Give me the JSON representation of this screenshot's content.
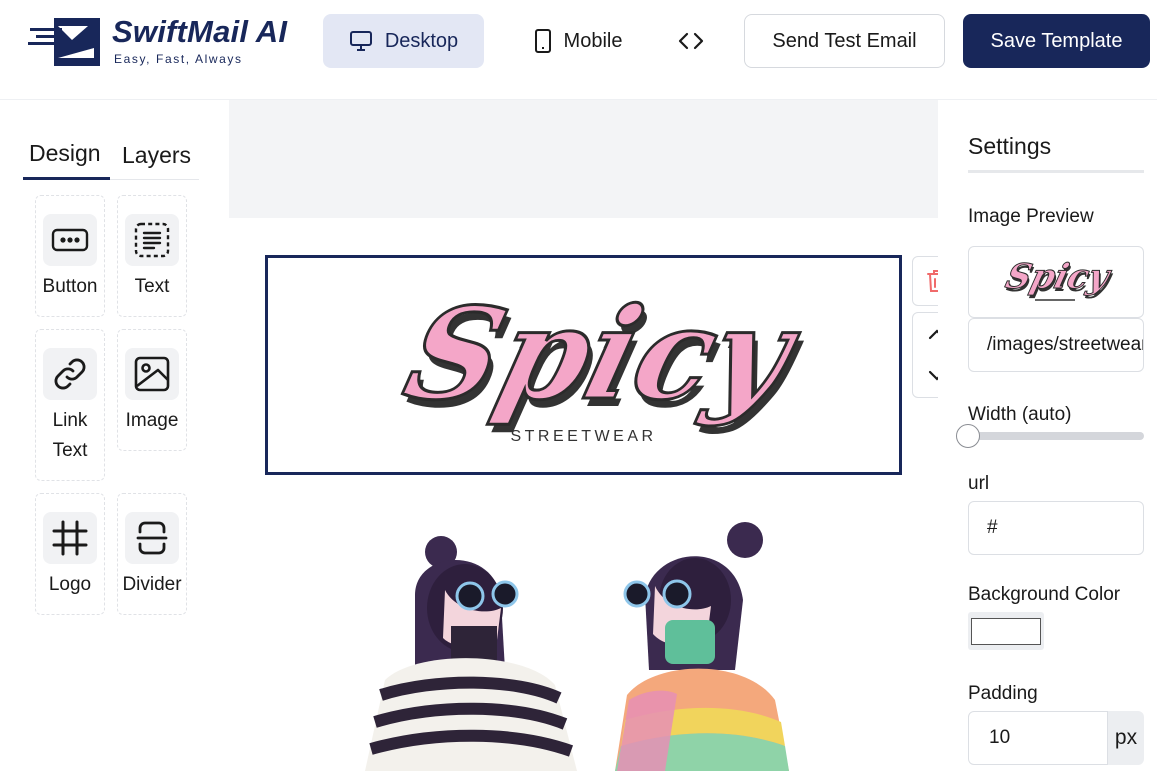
{
  "brand": {
    "name": "SwiftMail AI",
    "tagline": "Easy, Fast, Always",
    "color": "#18275a"
  },
  "toolbar": {
    "desktop_label": "Desktop",
    "mobile_label": "Mobile",
    "code_icon": "code-brackets-icon",
    "send_test_label": "Send Test Email",
    "save_label": "Save Template",
    "active_view": "Desktop"
  },
  "left_panel": {
    "tabs": [
      {
        "label": "Design",
        "active": true
      },
      {
        "label": "Layers",
        "active": false
      }
    ],
    "blocks": [
      {
        "label": "Button",
        "icon": "button-icon"
      },
      {
        "label": "Text",
        "icon": "text-icon"
      },
      {
        "label": "Link Text",
        "icon": "link-icon"
      },
      {
        "label": "Image",
        "icon": "image-icon"
      },
      {
        "label": "Logo",
        "icon": "hash-icon"
      },
      {
        "label": "Divider",
        "icon": "divider-icon"
      }
    ]
  },
  "canvas": {
    "logo_word": "Spicy",
    "logo_sub": "STREETWEAR",
    "logo_colors": {
      "fill": "#f4a6c8",
      "shadow": "#333333"
    },
    "tools": [
      "trash-icon",
      "chevron-up-icon",
      "chevron-down-icon"
    ]
  },
  "settings": {
    "title": "Settings",
    "image_preview_label": "Image Preview",
    "image_path": "/images/streetwear",
    "width_label": "Width (auto)",
    "width_level": 0,
    "url_label": "url",
    "url_value": "#",
    "bg_color_label": "Background Color",
    "bg_color_value": "#ffffff",
    "padding_label": "Padding",
    "padding_value": "10",
    "padding_unit": "px"
  }
}
